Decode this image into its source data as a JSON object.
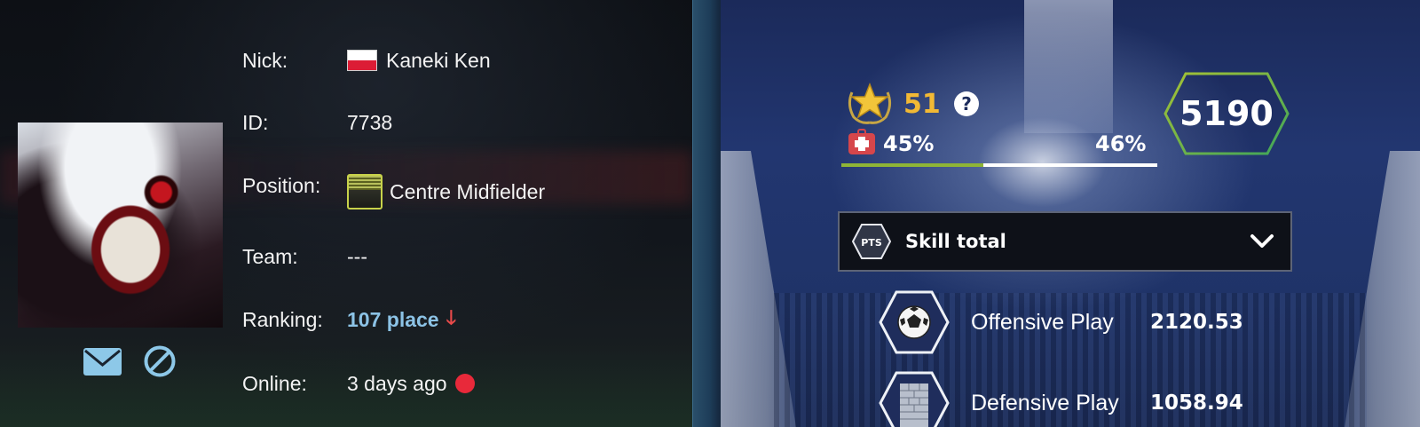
{
  "profile": {
    "nick_label": "Nick:",
    "nick": "Kaneki Ken",
    "id_label": "ID:",
    "id": "7738",
    "position_label": "Position:",
    "position": "Centre Midfielder",
    "team_label": "Team:",
    "team": "---",
    "ranking_label": "Ranking:",
    "ranking": "107 place",
    "ranking_arrow": "🡓",
    "online_label": "Online:",
    "online": "3 days ago"
  },
  "icons": {
    "mail": "envelope-icon",
    "block": "block-icon",
    "flag": "poland-flag-icon",
    "position": "midfielder-position-icon",
    "ranking_trend": "arrow-down-icon",
    "online_status": "offline-dot-icon",
    "level": "star-laurel-icon",
    "help": "question-icon",
    "health": "medical-kit-icon",
    "dropdown": "pts-badge-icon",
    "chevron": "chevron-down-icon",
    "offensive": "football-icon",
    "defensive": "brick-wall-icon"
  },
  "colors": {
    "level": "#f2b934",
    "ranking": "#8cc3e6",
    "ranking_arrow": "#e84a4a",
    "online_dot": "#e8293a",
    "progress_fill": "#8fb536",
    "hex_border_start": "#a6c234",
    "hex_border_end": "#3fa55a"
  },
  "stats": {
    "level": "51",
    "help": "?",
    "health_pct": "45%",
    "health_value": 0.45,
    "fitness_pct": "46%",
    "skill_total_value": "5190"
  },
  "skills": {
    "dropdown_badge": "PTS",
    "dropdown_label": "Skill total",
    "rows": [
      {
        "label": "Offensive Play",
        "value": "2120.53"
      },
      {
        "label": "Defensive Play",
        "value": "1058.94"
      }
    ]
  }
}
